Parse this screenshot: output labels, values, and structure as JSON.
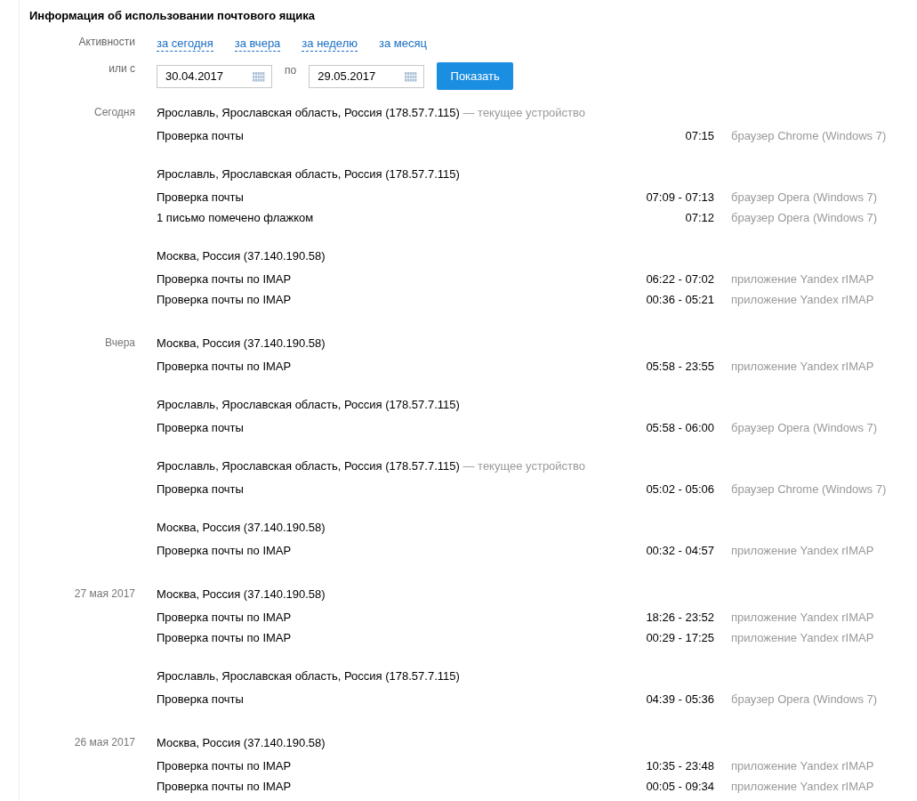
{
  "title": "Информация об использовании почтового ящика",
  "filter": {
    "label": "Активности",
    "periods": [
      {
        "label": "за сегодня",
        "selected": false
      },
      {
        "label": "за вчера",
        "selected": false
      },
      {
        "label": "за неделю",
        "selected": false
      },
      {
        "label": "за месяц",
        "selected": true
      }
    ],
    "range_label": "или с",
    "from": "30.04.2017",
    "to_label": "по",
    "to": "29.05.2017",
    "button": "Показать"
  },
  "days": [
    {
      "label": "Сегодня",
      "sessions": [
        {
          "location": "Ярославль, Ярославская область, Россия (178.57.7.115)",
          "note": "— текущее устройство",
          "activities": [
            {
              "action": "Проверка почты",
              "time": "07:15",
              "client": "браузер Chrome (Windows 7)"
            }
          ]
        },
        {
          "location": "Ярославль, Ярославская область, Россия (178.57.7.115)",
          "activities": [
            {
              "action": "Проверка почты",
              "time": "07:09 - 07:13",
              "client": "браузер Opera (Windows 7)"
            },
            {
              "action": "1 письмо помечено флажком",
              "time": "07:12",
              "client": "браузер Opera (Windows 7)"
            }
          ]
        },
        {
          "location": "Москва, Россия (37.140.190.58)",
          "activities": [
            {
              "action": "Проверка почты по IMAP",
              "time": "06:22 - 07:02",
              "client": "приложение Yandex rIMAP"
            },
            {
              "action": "Проверка почты по IMAP",
              "time": "00:36 - 05:21",
              "client": "приложение Yandex rIMAP"
            }
          ]
        }
      ]
    },
    {
      "label": "Вчера",
      "sessions": [
        {
          "location": "Москва, Россия (37.140.190.58)",
          "activities": [
            {
              "action": "Проверка почты по IMAP",
              "time": "05:58 - 23:55",
              "client": "приложение Yandex rIMAP"
            }
          ]
        },
        {
          "location": "Ярославль, Ярославская область, Россия (178.57.7.115)",
          "activities": [
            {
              "action": "Проверка почты",
              "time": "05:58 - 06:00",
              "client": "браузер Opera (Windows 7)"
            }
          ]
        },
        {
          "location": "Ярославль, Ярославская область, Россия (178.57.7.115)",
          "note": "— текущее устройство",
          "activities": [
            {
              "action": "Проверка почты",
              "time": "05:02 - 05:06",
              "client": "браузер Chrome (Windows 7)"
            }
          ]
        },
        {
          "location": "Москва, Россия (37.140.190.58)",
          "activities": [
            {
              "action": "Проверка почты по IMAP",
              "time": "00:32 - 04:57",
              "client": "приложение Yandex rIMAP"
            }
          ]
        }
      ]
    },
    {
      "label": "27 мая 2017",
      "sessions": [
        {
          "location": "Москва, Россия (37.140.190.58)",
          "activities": [
            {
              "action": "Проверка почты по IMAP",
              "time": "18:26 - 23:52",
              "client": "приложение Yandex rIMAP"
            },
            {
              "action": "Проверка почты по IMAP",
              "time": "00:29 - 17:25",
              "client": "приложение Yandex rIMAP"
            }
          ]
        },
        {
          "location": "Ярославль, Ярославская область, Россия (178.57.7.115)",
          "activities": [
            {
              "action": "Проверка почты",
              "time": "04:39 - 05:36",
              "client": "браузер Opera (Windows 7)"
            }
          ]
        }
      ]
    },
    {
      "label": "26 мая 2017",
      "sessions": [
        {
          "location": "Москва, Россия (37.140.190.58)",
          "activities": [
            {
              "action": "Проверка почты по IMAP",
              "time": "10:35 - 23:48",
              "client": "приложение Yandex rIMAP"
            },
            {
              "action": "Проверка почты по IMAP",
              "time": "00:05 - 09:34",
              "client": "приложение Yandex rIMAP"
            }
          ]
        }
      ]
    }
  ]
}
